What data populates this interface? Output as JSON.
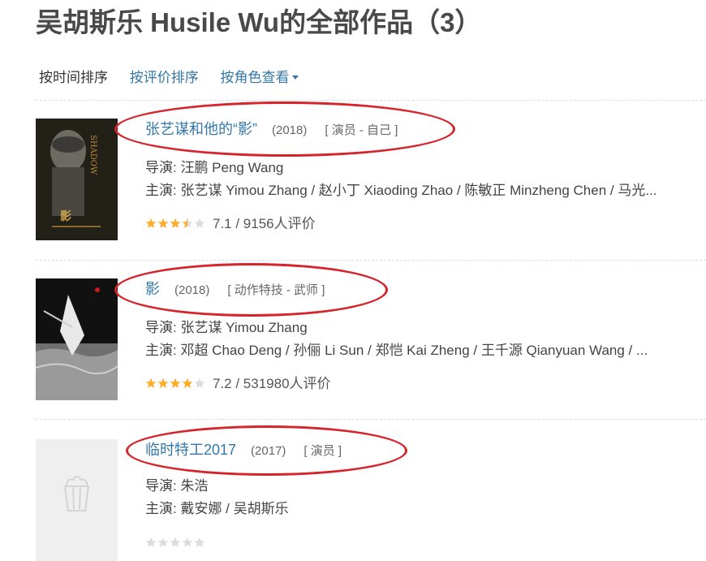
{
  "page": {
    "title": "吴胡斯乐 Husile Wu的全部作品（3）"
  },
  "sort_bar": {
    "by_time": "按时间排序",
    "by_rating": "按评价排序",
    "by_role": "按角色查看"
  },
  "colors": {
    "link": "#3377aa",
    "star": "#ffac2d",
    "annotation_ellipse": "#d6242b"
  },
  "works": [
    {
      "title": "张艺谋和他的“影”",
      "year": "(2018)",
      "role": "[ 演员 - 自己 ]",
      "director": "导演: 汪鹏 Peng Wang",
      "cast": "主演: 张艺谋 Yimou Zhang / 赵小丁 Xiaoding Zhao / 陈敏正 Minzheng Chen / 马光...",
      "rating_text": "7.1 / 9156人评价",
      "stars": 3.5
    },
    {
      "title": "影",
      "year": "(2018)",
      "role": "[ 动作特技 - 武师 ]",
      "director": "导演: 张艺谋 Yimou Zhang",
      "cast": "主演: 邓超 Chao Deng / 孙俪 Li Sun / 郑恺 Kai Zheng / 王千源 Qianyuan Wang / ...",
      "rating_text": "7.2 / 531980人评价",
      "stars": 4
    },
    {
      "title": "临时特工2017",
      "year": "(2017)",
      "role": "[ 演员 ]",
      "director": "导演: 朱浩",
      "cast": "主演: 戴安娜 / 吴胡斯乐",
      "rating_text": "",
      "stars": 0
    }
  ]
}
